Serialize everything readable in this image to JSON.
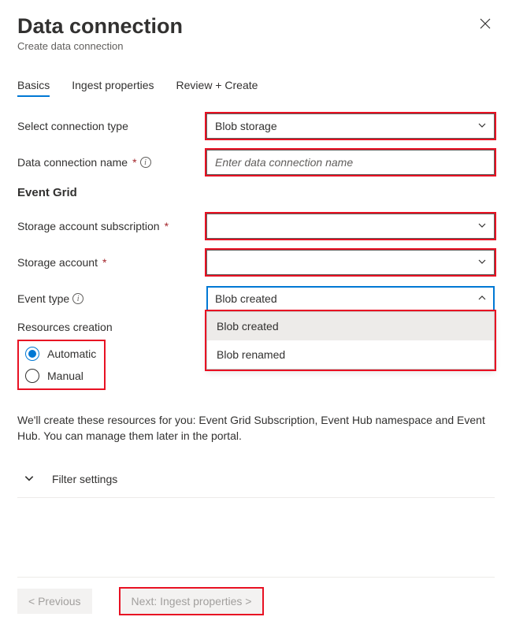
{
  "header": {
    "title": "Data connection",
    "subtitle": "Create data connection"
  },
  "tabs": [
    {
      "label": "Basics",
      "active": true
    },
    {
      "label": "Ingest properties",
      "active": false
    },
    {
      "label": "Review + Create",
      "active": false
    }
  ],
  "fields": {
    "connection_type": {
      "label": "Select connection type",
      "value": "Blob storage"
    },
    "connection_name": {
      "label": "Data connection name",
      "placeholder": "Enter data connection name",
      "value": ""
    },
    "event_grid_heading": "Event Grid",
    "subscription": {
      "label": "Storage account subscription",
      "value": ""
    },
    "storage_account": {
      "label": "Storage account",
      "value": ""
    },
    "event_type": {
      "label": "Event type",
      "value": "Blob created",
      "options": [
        "Blob created",
        "Blob renamed"
      ]
    },
    "resources_creation": {
      "label": "Resources creation",
      "options": [
        "Automatic",
        "Manual"
      ],
      "selected": "Automatic"
    }
  },
  "helper_text": "We'll create these resources for you: Event Grid Subscription, Event Hub namespace and Event Hub. You can manage them later in the portal.",
  "filter_settings_label": "Filter settings",
  "footer": {
    "previous": "< Previous",
    "next": "Next: Ingest properties >"
  }
}
